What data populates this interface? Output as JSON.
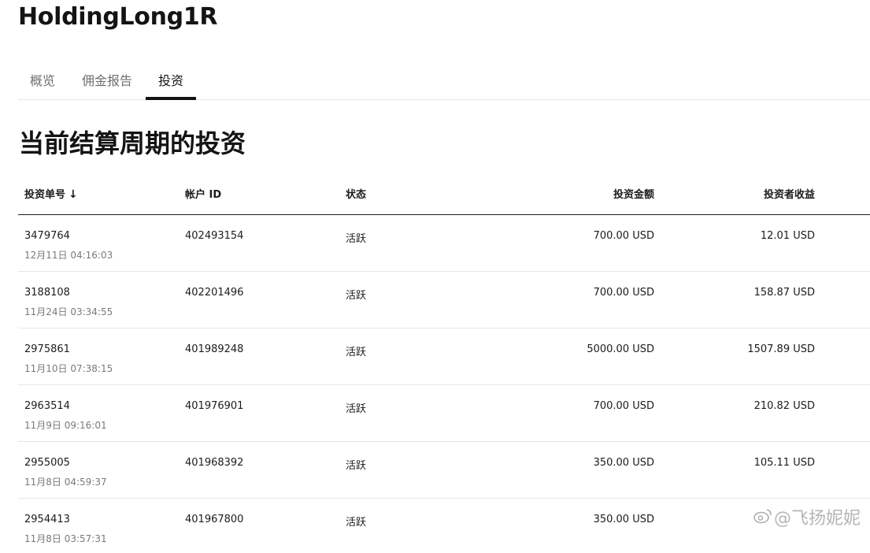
{
  "page": {
    "title": "HoldingLong1R"
  },
  "tabs": [
    {
      "label": "概览",
      "active": false
    },
    {
      "label": "佣金报告",
      "active": false
    },
    {
      "label": "投资",
      "active": true
    }
  ],
  "section": {
    "title": "当前结算周期的投资"
  },
  "table": {
    "headers": {
      "investment_id": "投资单号",
      "sort_icon": "↓",
      "account_id": "帐户 ID",
      "status": "状态",
      "amount": "投资金额",
      "income": "投资者收益"
    },
    "rows": [
      {
        "id": "3479764",
        "date": "12月11日 04:16:03",
        "account": "402493154",
        "status": "活跃",
        "amount": "700.00 USD",
        "income": "12.01 USD"
      },
      {
        "id": "3188108",
        "date": "11月24日 03:34:55",
        "account": "402201496",
        "status": "活跃",
        "amount": "700.00 USD",
        "income": "158.87 USD"
      },
      {
        "id": "2975861",
        "date": "11月10日 07:38:15",
        "account": "401989248",
        "status": "活跃",
        "amount": "5000.00 USD",
        "income": "1507.89 USD"
      },
      {
        "id": "2963514",
        "date": "11月9日 09:16:01",
        "account": "401976901",
        "status": "活跃",
        "amount": "700.00 USD",
        "income": "210.82 USD"
      },
      {
        "id": "2955005",
        "date": "11月8日 04:59:37",
        "account": "401968392",
        "status": "活跃",
        "amount": "350.00 USD",
        "income": "105.11 USD"
      },
      {
        "id": "2954413",
        "date": "11月8日 03:57:31",
        "account": "401967800",
        "status": "活跃",
        "amount": "350.00 USD",
        "income": ""
      }
    ]
  },
  "watermark": {
    "icon": "weibo-icon",
    "text": "@飞扬妮妮"
  }
}
